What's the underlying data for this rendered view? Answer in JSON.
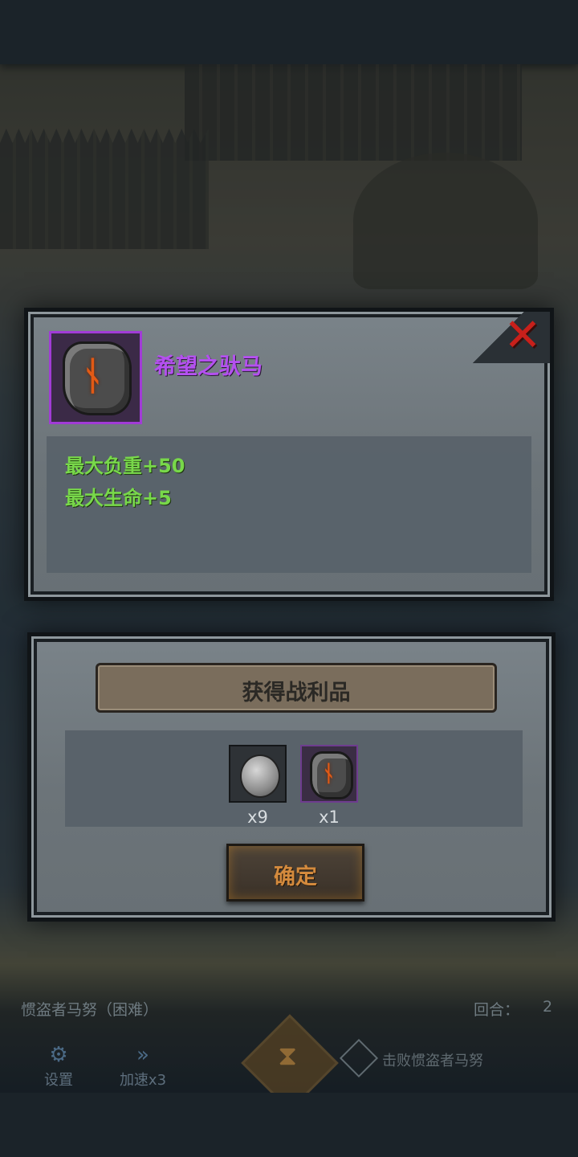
{
  "item": {
    "name": "希望之驮马",
    "stats": [
      "最大负重+50",
      "最大生命+5"
    ],
    "rarity_color": "#b450f0",
    "icon": "rune-stone-icon"
  },
  "close_icon": "close-icon",
  "loot": {
    "title": "获得战利品",
    "items": [
      {
        "icon": "silver-coin-icon",
        "count": "x9"
      },
      {
        "icon": "rune-stone-icon",
        "count": "x1"
      }
    ],
    "confirm_label": "确定"
  },
  "hud": {
    "boss_name": "惯盗者马努（困难）",
    "round_label": "回合：",
    "round_value": "2",
    "settings_label": "设置",
    "speed_label": "加速x3",
    "goal_text": "击败惯盗者马努"
  }
}
